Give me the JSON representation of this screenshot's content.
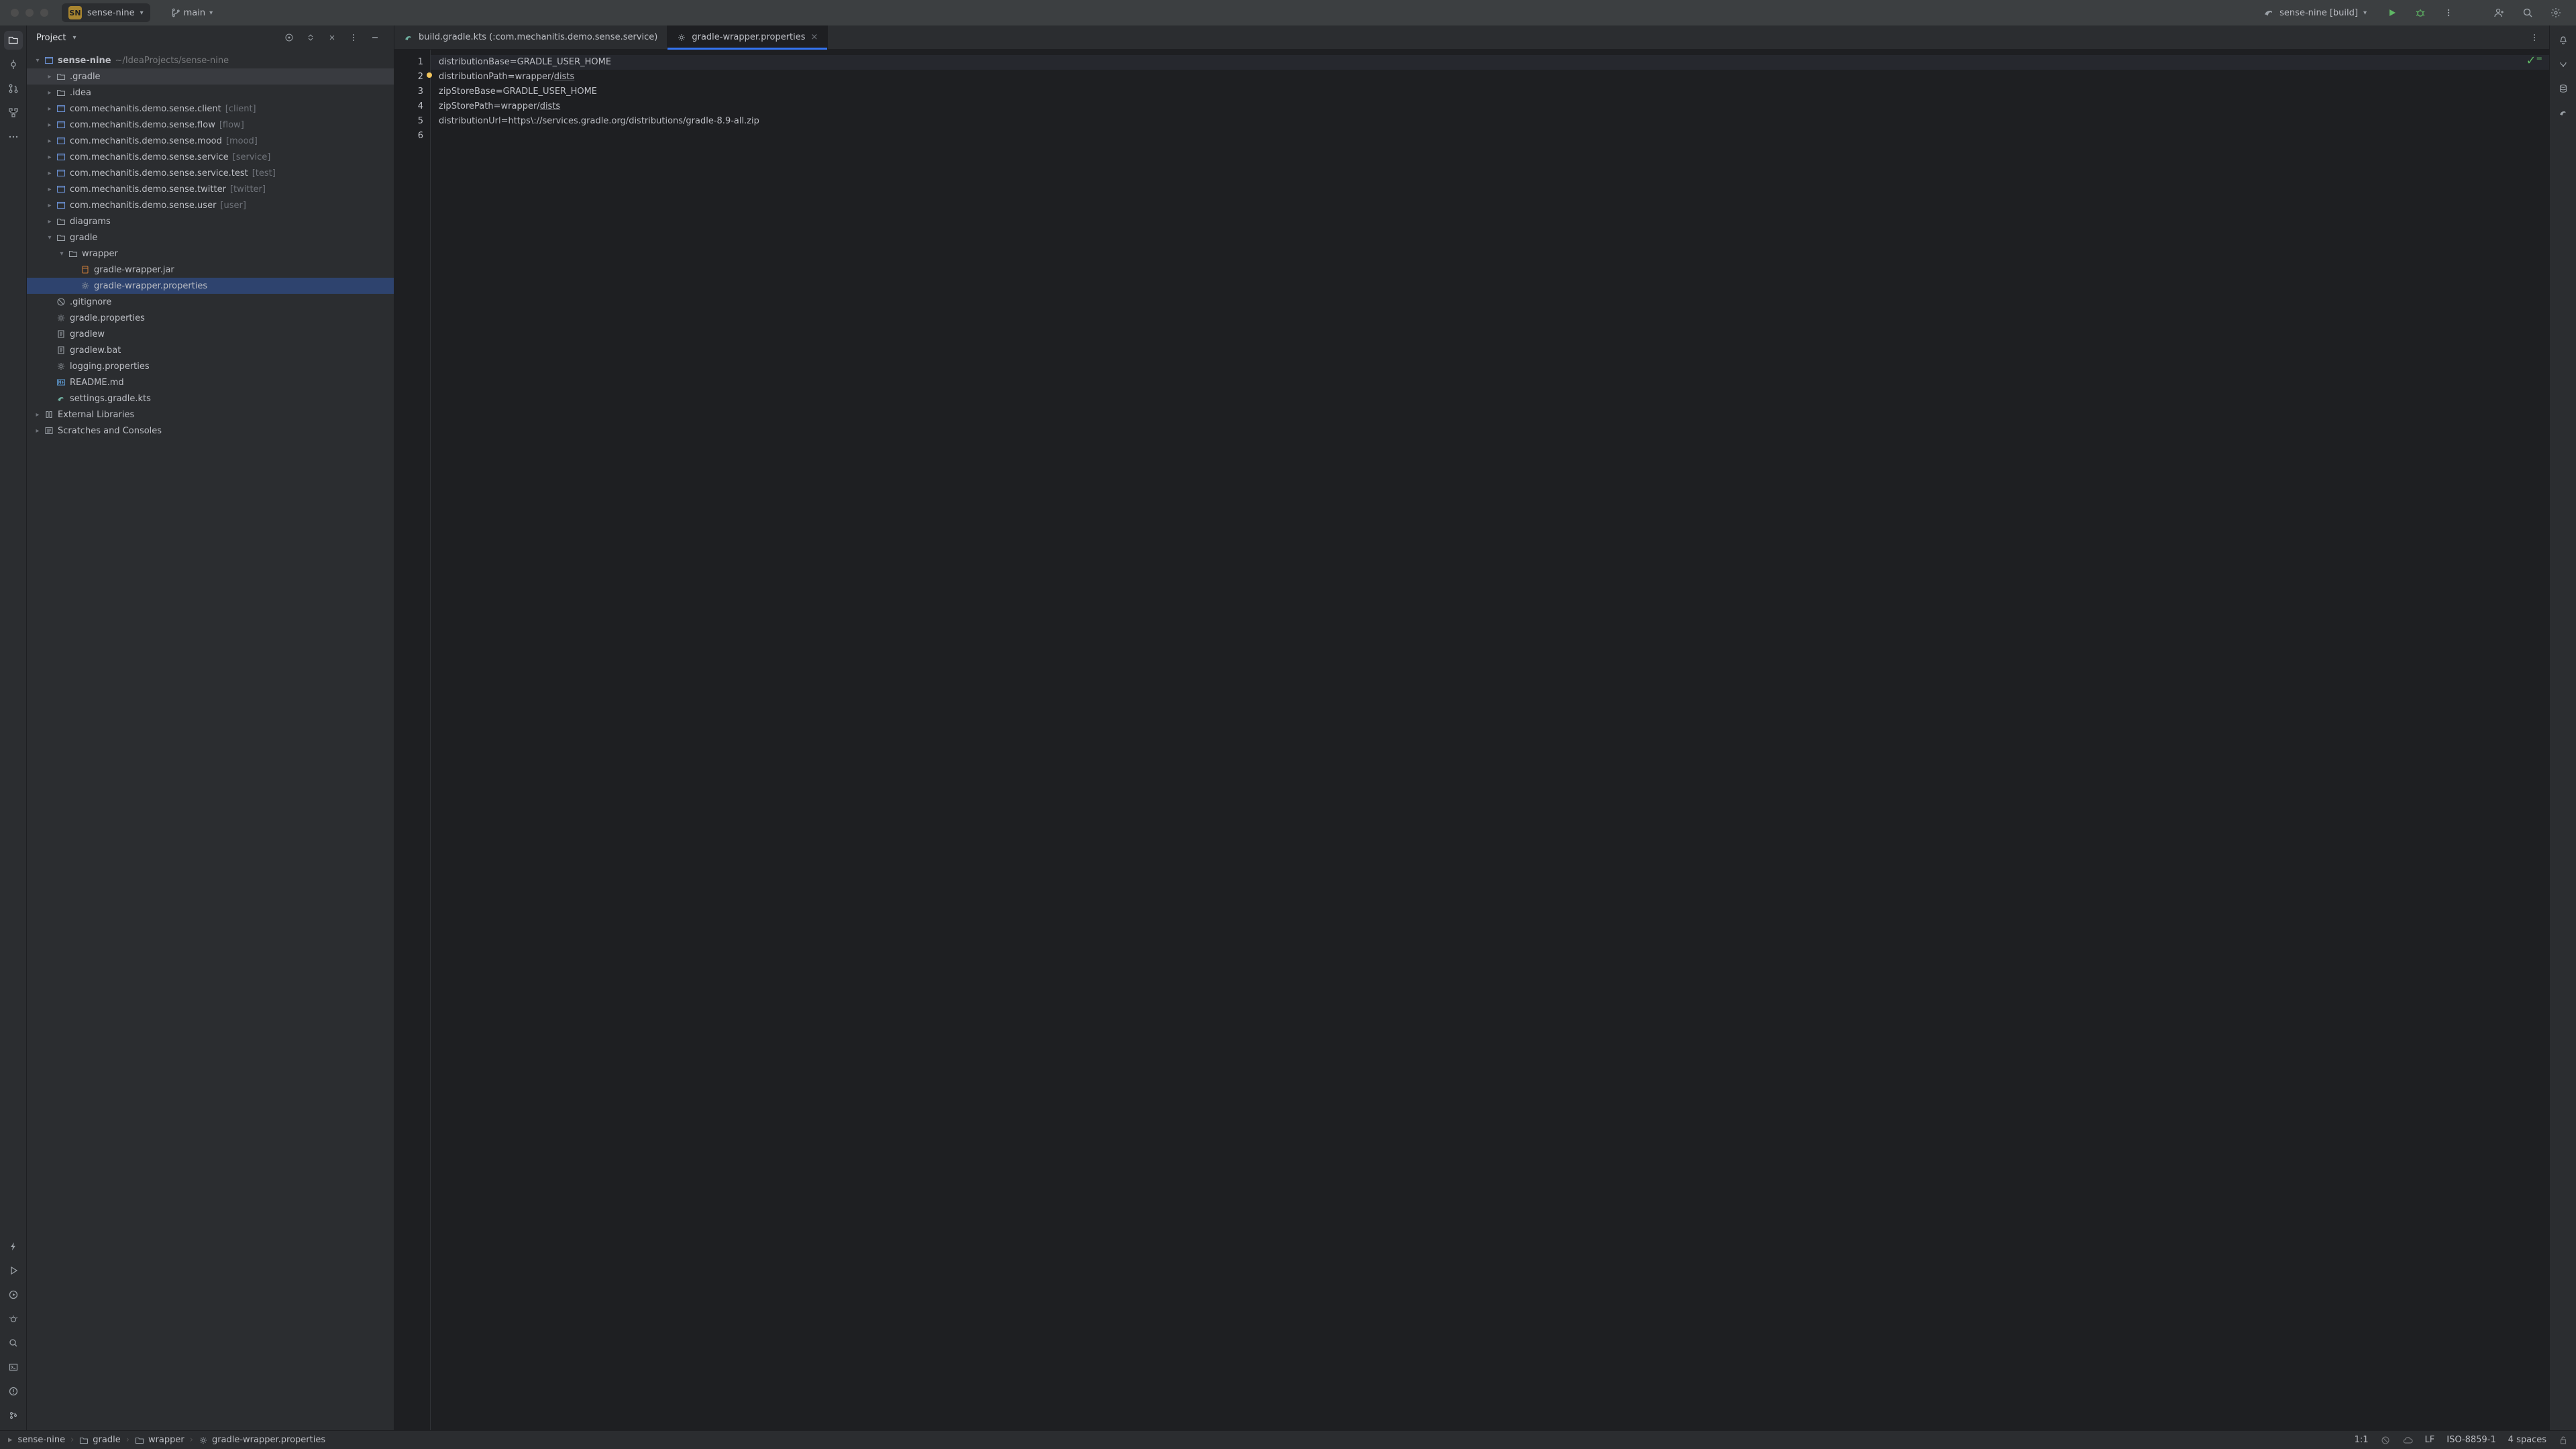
{
  "titlebar": {
    "project_badge": "SN",
    "project_name": "sense-nine",
    "branch": "main",
    "run_config": "sense-nine [build]"
  },
  "panel": {
    "title": "Project"
  },
  "tree": {
    "root": {
      "name": "sense-nine",
      "path": "~/IdeaProjects/sense-nine"
    },
    "items": [
      {
        "name": ".gradle",
        "type": "folder",
        "d": 1,
        "arrow": "right"
      },
      {
        "name": ".idea",
        "type": "folder",
        "d": 1,
        "arrow": "right"
      },
      {
        "name": "com.mechanitis.demo.sense.client",
        "suffix": "[client]",
        "type": "module",
        "d": 1,
        "arrow": "right"
      },
      {
        "name": "com.mechanitis.demo.sense.flow",
        "suffix": "[flow]",
        "type": "module",
        "d": 1,
        "arrow": "right"
      },
      {
        "name": "com.mechanitis.demo.sense.mood",
        "suffix": "[mood]",
        "type": "module",
        "d": 1,
        "arrow": "right"
      },
      {
        "name": "com.mechanitis.demo.sense.service",
        "suffix": "[service]",
        "type": "module",
        "d": 1,
        "arrow": "right"
      },
      {
        "name": "com.mechanitis.demo.sense.service.test",
        "suffix": "[test]",
        "type": "module",
        "d": 1,
        "arrow": "right"
      },
      {
        "name": "com.mechanitis.demo.sense.twitter",
        "suffix": "[twitter]",
        "type": "module",
        "d": 1,
        "arrow": "right"
      },
      {
        "name": "com.mechanitis.demo.sense.user",
        "suffix": "[user]",
        "type": "module",
        "d": 1,
        "arrow": "right"
      },
      {
        "name": "diagrams",
        "type": "folder",
        "d": 1,
        "arrow": "right"
      },
      {
        "name": "gradle",
        "type": "folder",
        "d": 1,
        "arrow": "down"
      },
      {
        "name": "wrapper",
        "type": "folder",
        "d": 2,
        "arrow": "down"
      },
      {
        "name": "gradle-wrapper.jar",
        "type": "jar",
        "d": 3
      },
      {
        "name": "gradle-wrapper.properties",
        "type": "gear",
        "d": 3,
        "selected": true
      },
      {
        "name": ".gitignore",
        "type": "ignore",
        "d": 1
      },
      {
        "name": "gradle.properties",
        "type": "gear",
        "d": 1
      },
      {
        "name": "gradlew",
        "type": "file",
        "d": 1
      },
      {
        "name": "gradlew.bat",
        "type": "file",
        "d": 1
      },
      {
        "name": "logging.properties",
        "type": "gear",
        "d": 1
      },
      {
        "name": "README.md",
        "type": "md",
        "d": 1
      },
      {
        "name": "settings.gradle.kts",
        "type": "gradle",
        "d": 1
      }
    ],
    "external": "External Libraries",
    "scratch": "Scratches and Consoles"
  },
  "tabs": [
    {
      "icon": "gradle",
      "label": "build.gradle.kts (:com.mechanitis.demo.sense.service)"
    },
    {
      "icon": "gear",
      "label": "gradle-wrapper.properties",
      "active": true
    }
  ],
  "code": {
    "lines": [
      {
        "n": 1,
        "k": "distributionBase",
        "v": "GRADLE_USER_HOME",
        "hl": true
      },
      {
        "n": 2,
        "k": "distributionPath",
        "v": "wrapper/",
        "u": "dists"
      },
      {
        "n": 3,
        "k": "zipStoreBase",
        "v": "GRADLE_USER_HOME"
      },
      {
        "n": 4,
        "k": "zipStorePath",
        "v": "wrapper/",
        "u": "dists"
      },
      {
        "n": 5,
        "k": "distributionUrl",
        "v": "https",
        "rest": "\\://services.gradle.org/distributions/gradle-8.9-all.zip"
      },
      {
        "n": 6,
        "k": "",
        "v": ""
      }
    ]
  },
  "breadcrumbs": [
    "sense-nine",
    "gradle",
    "wrapper",
    "gradle-wrapper.properties"
  ],
  "status": {
    "pos": "1:1",
    "sep": "LF",
    "enc": "ISO-8859-1",
    "indent": "4 spaces"
  }
}
